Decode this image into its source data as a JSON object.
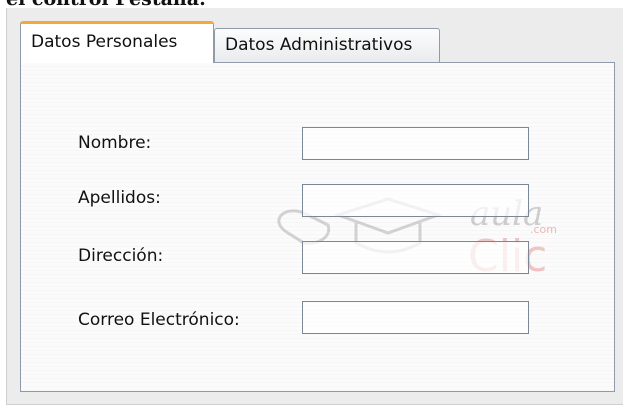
{
  "caption": "el control Pestaña:",
  "tabs": [
    {
      "label": "Datos Personales"
    },
    {
      "label": "Datos Administrativos"
    }
  ],
  "form": {
    "fields": [
      {
        "label": "Nombre:",
        "value": ""
      },
      {
        "label": "Apellidos:",
        "value": ""
      },
      {
        "label": "Dirección:",
        "value": ""
      },
      {
        "label": "Correo Electrónico:",
        "value": ""
      }
    ]
  },
  "watermark": {
    "brand_top": "aula",
    "brand_sub": ".com",
    "brand_main": "Clic"
  },
  "colors": {
    "active_tab_accent": "#f3a83b",
    "tab_border": "#8f9ba8"
  }
}
